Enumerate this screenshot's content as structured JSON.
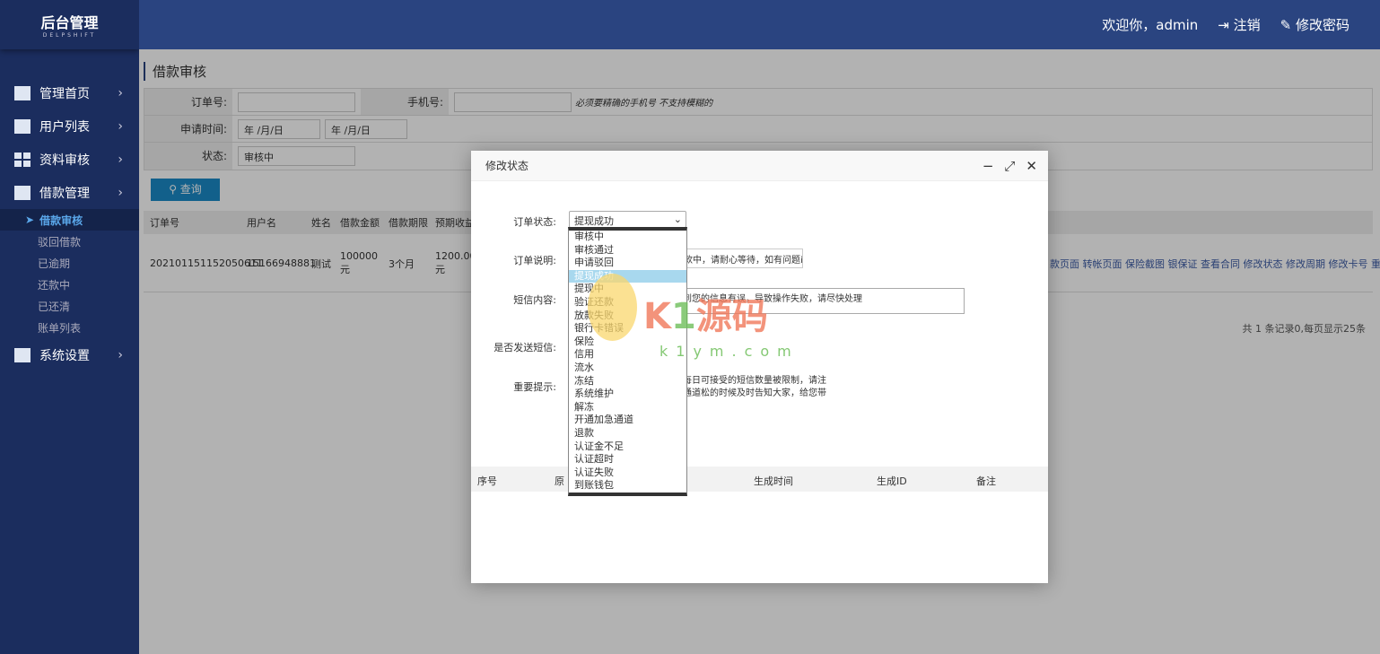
{
  "sidebar": {
    "logo_title": "后台管理",
    "logo_sub": "DELPSHIFT",
    "items": [
      {
        "label": "管理首页"
      },
      {
        "label": "用户列表"
      },
      {
        "label": "资料审核"
      },
      {
        "label": "借款管理"
      }
    ],
    "subitems": [
      {
        "label": "借款审核"
      },
      {
        "label": "驳回借款"
      },
      {
        "label": "已逾期"
      },
      {
        "label": "还款中"
      },
      {
        "label": "已还清"
      },
      {
        "label": "账单列表"
      }
    ],
    "settings": "系统设置"
  },
  "header": {
    "welcome": "欢迎你，admin",
    "logout": "注销",
    "change_pwd": "修改密码"
  },
  "page": {
    "title": "借款审核",
    "order_label": "订单号:",
    "phone_label": "手机号:",
    "phone_hint": "必须要精确的手机号 不支持模糊的",
    "date_label": "申请时间:",
    "date_ph": "年 /月/日",
    "status_label": "状态:",
    "status_value": "审核中",
    "search": "查询"
  },
  "table": {
    "headers": [
      "订单号",
      "用户名",
      "姓名",
      "借款金额",
      "借款期限",
      "预期收益"
    ],
    "row": {
      "order": "202101151152050611",
      "user": "15166948881",
      "name": "测试",
      "amount": "100000元",
      "term": "3个月",
      "income": "1200.00元",
      "ops": "款页面 转帐页面 保险截图 银保证 查看合同 修改状态 修改周期 修改卡号 重发短信 删"
    }
  },
  "pagination": "共 1 条记录0,每页显示25条",
  "modal": {
    "title": "修改状态",
    "status_label": "订单状态:",
    "status_value": "提现成功",
    "desc_label": "订单说明:",
    "desc_value": "款中，请耐心等待，如有问题i",
    "sms_label": "短信内容:",
    "sms_value": "到您的信息有误，导致操作失败，请尽快处理",
    "send_label": "是否发送短信:",
    "tip_label": "重要提示:",
    "tip_line1": "每日可接受的短信数量被限制，请注",
    "tip_line2": "通道松的时候及时告知大家，给您带",
    "options": [
      "审核中",
      "审核通过",
      "申请驳回",
      "提现成功",
      "提现中",
      "验证还款",
      "放款失败",
      "银行卡错误",
      "保险",
      "信用",
      "流水",
      "冻结",
      "系统维护",
      "解冻",
      "开通加急通道",
      "退款",
      "认证金不足",
      "认证超时",
      "认证失败",
      "到账钱包"
    ],
    "table_headers": [
      "序号",
      "原",
      "生成时间",
      "生成ID",
      "备注"
    ]
  },
  "watermark": {
    "brand": "K1源码",
    "url": "k1ym.com"
  }
}
